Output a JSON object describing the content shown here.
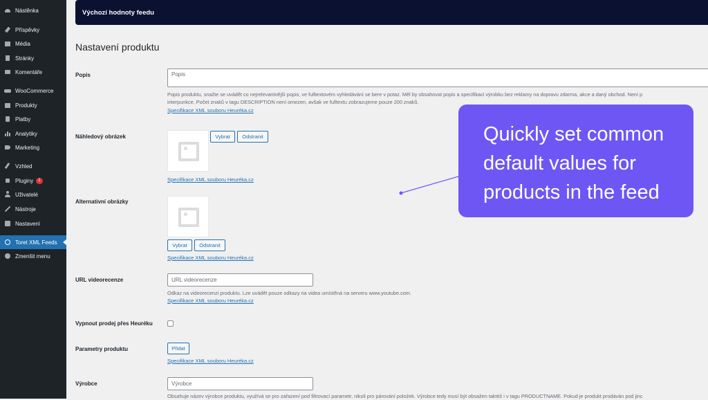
{
  "sidebar": {
    "items": [
      {
        "label": "Nástěnka",
        "icon": "dashboard-icon"
      },
      {
        "label": "Příspěvky",
        "icon": "pin-icon"
      },
      {
        "label": "Média",
        "icon": "media-icon"
      },
      {
        "label": "Stránky",
        "icon": "pages-icon"
      },
      {
        "label": "Komentáře",
        "icon": "comments-icon"
      },
      {
        "label": "WooCommerce",
        "icon": "woocommerce-icon"
      },
      {
        "label": "Produkty",
        "icon": "products-icon"
      },
      {
        "label": "Platby",
        "icon": "payments-icon"
      },
      {
        "label": "Analytiky",
        "icon": "analytics-icon"
      },
      {
        "label": "Marketing",
        "icon": "megaphone-icon"
      },
      {
        "label": "Vzhled",
        "icon": "brush-icon"
      },
      {
        "label": "Pluginy",
        "icon": "plugin-icon",
        "badge": "1"
      },
      {
        "label": "Uživatelé",
        "icon": "users-icon"
      },
      {
        "label": "Nástroje",
        "icon": "wrench-icon"
      },
      {
        "label": "Nastavení",
        "icon": "settings-icon"
      },
      {
        "label": "Toret XML Feeds",
        "icon": "toret-icon",
        "active": true
      },
      {
        "label": "Zmenšit menu",
        "icon": "collapse-icon"
      }
    ]
  },
  "header": {
    "title": "Výchozí hodnoty feedu"
  },
  "section_title": "Nastavení produktu",
  "spec_link": "Specifikace XML souboru Heuréka.cz",
  "fields": {
    "popis": {
      "label": "Popis",
      "placeholder": "Popis",
      "desc_line1": "Popis produktu, snažte se uvádět co nejrelevantnější popis, ve fulltextovém vyhledávání se bere v potaz. Měl by obsahovat popis a specifikaci výrobku bez reklamy na dopravu zdarma, akce a daný obchod. Není p",
      "desc_line2": "interpunkce. Počet znaků v tagu DESCRIPTION není omezen, avšak ve fulltextu zobrazujeme pouze 200 znaků."
    },
    "nahled": {
      "label": "Náhledový obrázek",
      "select_btn": "Vybrat",
      "remove_btn": "Odstranit"
    },
    "alt": {
      "label": "Alternativní obrázky",
      "select_btn": "Vybrat",
      "remove_btn": "Odstranit"
    },
    "video": {
      "label": "URL videorecenze",
      "placeholder": "URL videorecenze",
      "desc": "Odkaz na videorecenzi produktu. Lze uvádět pouze odkazy na videa umístěná na serveru www.youtube.com."
    },
    "disable": {
      "label": "Vypnout prodej přes Heuréku",
      "checked": false
    },
    "params": {
      "label": "Parametry produktu",
      "add_btn": "Přidat"
    },
    "vyrobce": {
      "label": "Výrobce",
      "placeholder": "Výrobce",
      "desc": "Obsahuje název výrobce produktu, využívá se pro zařazení pod filtrovací parametr, nikoli pro párování položek. Výrobce tedy musí být obsažen taktéž i v tagu PRODUCTNAME. Pokud je produkt prodáván pod jinc"
    }
  },
  "callout": {
    "lines": [
      "Quickly set common",
      "default values for",
      "products in the feed"
    ],
    "color": "#6e56f5"
  }
}
